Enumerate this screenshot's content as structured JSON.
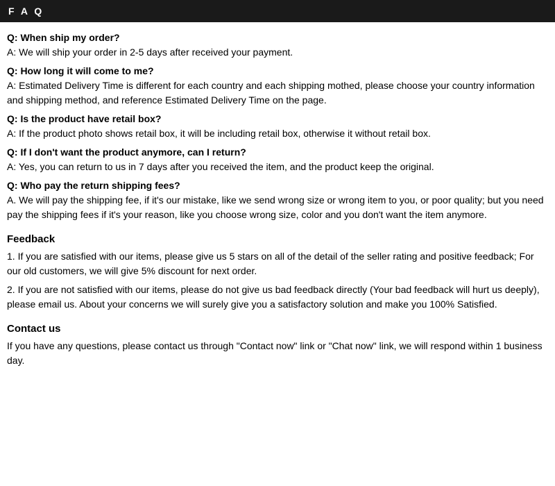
{
  "header": {
    "title": "F A Q"
  },
  "faq": {
    "items": [
      {
        "question": "Q: When ship my order?",
        "answer": "A: We will ship your order in 2-5 days after received your payment."
      },
      {
        "question": "Q: How long it will come to me?",
        "answer": "A: Estimated Delivery Time is different for each country and each shipping mothed, please choose your country information and shipping method, and reference Estimated Delivery Time on the page."
      },
      {
        "question": "Q: Is the product have retail box?",
        "answer": "A: If the product photo shows retail box, it will be including retail box, otherwise it without retail box."
      },
      {
        "question": "Q: If I don't want the product anymore, can I return?",
        "answer": "A: Yes, you can return to us in 7 days after you received the item, and the product keep the original."
      },
      {
        "question": "Q: Who pay the return shipping fees?",
        "answer": "A. We will pay the shipping fee, if it's our mistake, like we send wrong size or wrong item to you, or poor quality; but you need pay the shipping fees if it's your reason, like you choose wrong size, color and you don't want the item anymore."
      }
    ]
  },
  "feedback": {
    "title": "Feedback",
    "items": [
      "1.  If you are satisfied with our items, please give us 5 stars on all of the detail of the seller rating and positive feedback; For our old customers, we will give 5% discount for next order.",
      "2.  If you are not satisfied with our items, please do not give us bad feedback directly (Your bad feedback will hurt us deeply), please email us. About your concerns we will surely give you a satisfactory solution and make you 100% Satisfied."
    ]
  },
  "contact": {
    "title": "Contact us",
    "text": "If you have any questions, please contact us through \"Contact now\" link or \"Chat now\" link, we will respond within 1 business day."
  }
}
